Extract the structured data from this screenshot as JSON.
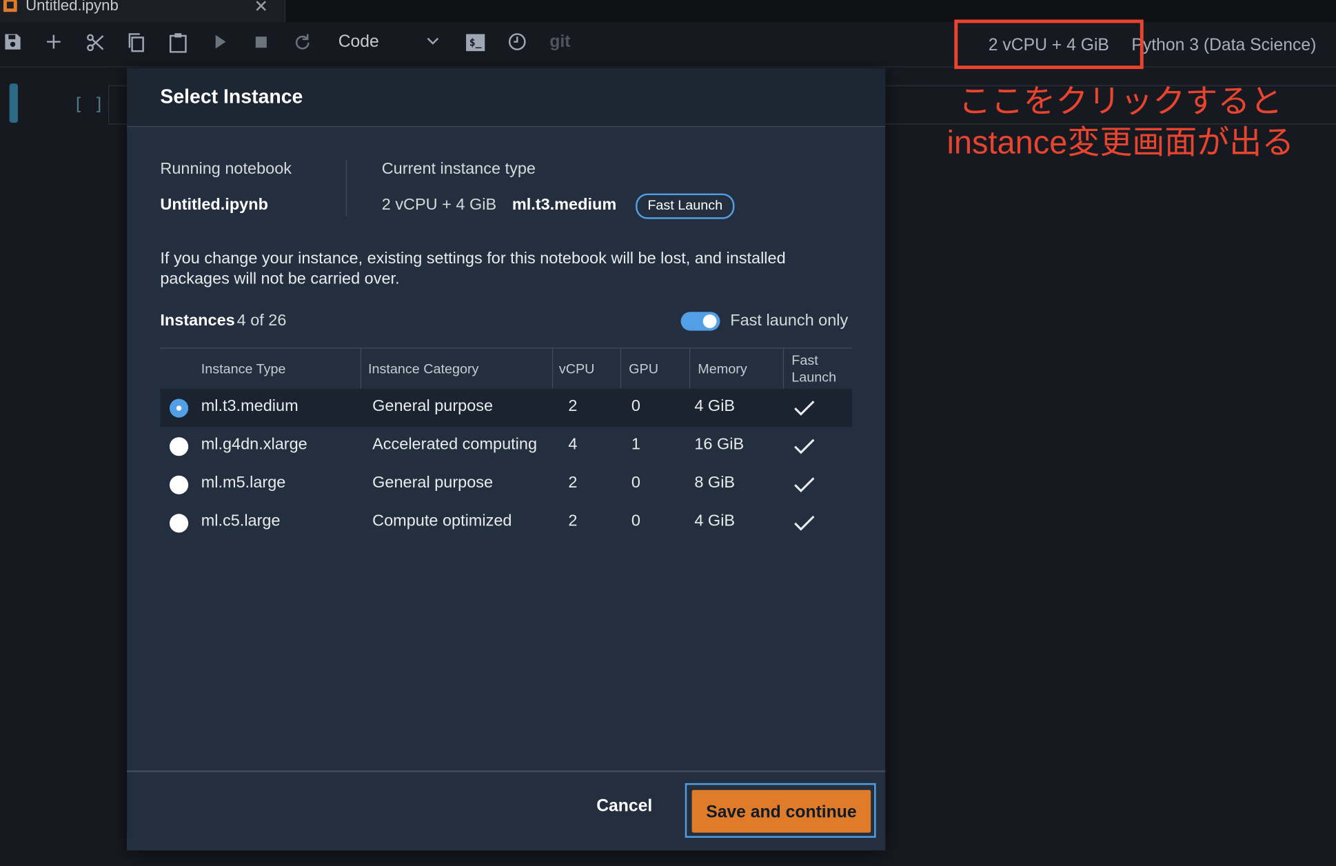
{
  "tab": {
    "title": "Untitled.ipynb",
    "close_glyph": "✕"
  },
  "toolbar": {
    "cell_type": "Code",
    "terminal_glyph": "$_",
    "git_label": "git",
    "instance_indicator": "2 vCPU + 4 GiB",
    "kernel_name": "Python 3 (Data Science)"
  },
  "cell": {
    "prompt": "[ ]:"
  },
  "annotation": {
    "line1": "ここをクリックすると",
    "line2": "instance変更画面が出る",
    "color": "#e8442f"
  },
  "modal": {
    "title": "Select Instance",
    "running_notebook_label": "Running notebook",
    "running_notebook_value": "Untitled.ipynb",
    "current_instance_label": "Current instance type",
    "current_instance_spec": "2 vCPU + 4 GiB",
    "current_instance_name": "ml.t3.medium",
    "current_instance_badge": "Fast Launch",
    "warning": "If you change your instance, existing settings for this notebook will be lost, and installed packages will not be carried over.",
    "instances_label": "Instances",
    "instances_count": "4 of 26",
    "fast_launch_toggle_label": "Fast launch only",
    "fast_launch_toggle_on": true,
    "table": {
      "headers": [
        "Instance Type",
        "Instance Category",
        "vCPU",
        "GPU",
        "Memory",
        "Fast Launch"
      ],
      "rows": [
        {
          "type": "ml.t3.medium",
          "category": "General purpose",
          "vcpu": "2",
          "gpu": "0",
          "memory": "4 GiB",
          "fast_launch": true,
          "selected": true
        },
        {
          "type": "ml.g4dn.xlarge",
          "category": "Accelerated computing",
          "vcpu": "4",
          "gpu": "1",
          "memory": "16 GiB",
          "fast_launch": true,
          "selected": false
        },
        {
          "type": "ml.m5.large",
          "category": "General purpose",
          "vcpu": "2",
          "gpu": "0",
          "memory": "8 GiB",
          "fast_launch": true,
          "selected": false
        },
        {
          "type": "ml.c5.large",
          "category": "Compute optimized",
          "vcpu": "2",
          "gpu": "0",
          "memory": "4 GiB",
          "fast_launch": true,
          "selected": false
        }
      ]
    },
    "cancel_label": "Cancel",
    "save_label": "Save and continue"
  },
  "colors": {
    "accent": "#539fe5",
    "primary_button": "#e07b2a",
    "highlight": "#e8442f"
  },
  "icons": [
    "save-icon",
    "add-cell-icon",
    "cut-icon",
    "copy-icon",
    "paste-icon",
    "run-icon",
    "stop-icon",
    "restart-icon",
    "chevron-down-icon",
    "terminal-icon",
    "clock-icon",
    "check-icon"
  ]
}
